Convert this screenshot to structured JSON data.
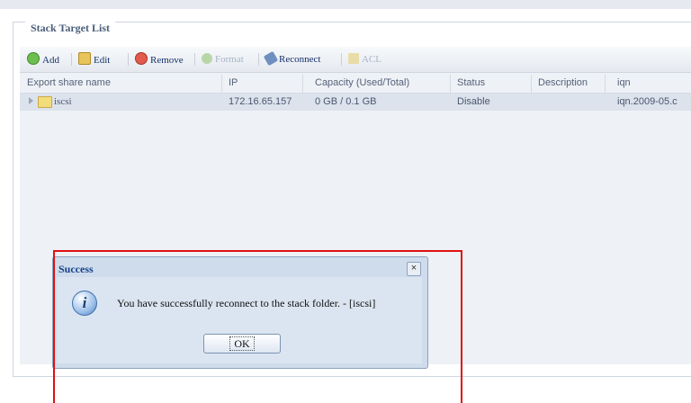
{
  "legend": "Stack Target List",
  "toolbar": {
    "add": "Add",
    "edit": "Edit",
    "remove": "Remove",
    "format": "Format",
    "reconnect": "Reconnect",
    "acl": "ACL"
  },
  "table": {
    "columns": [
      "Export share name",
      "IP",
      "Capacity (Used/Total)",
      "Status",
      "Description",
      "iqn"
    ],
    "rows": [
      {
        "name": "iscsi",
        "ip": "172.16.65.157",
        "capacity": "0 GB / 0.1 GB",
        "status": "Disable",
        "description": "",
        "iqn": "iqn.2009-05.c"
      }
    ]
  },
  "dialog": {
    "title": "Success",
    "close": "×",
    "info_glyph": "i",
    "message": "You have successfully reconnect to the stack folder. - [iscsi]",
    "ok": "OK"
  },
  "colors": {
    "highlight_box": "#e01010",
    "title_blue": "#15428b"
  },
  "icons": [
    "add-icon",
    "edit-icon",
    "remove-icon",
    "format-icon",
    "reconnect-icon",
    "acl-icon",
    "folder-icon",
    "info-icon",
    "close-icon"
  ]
}
